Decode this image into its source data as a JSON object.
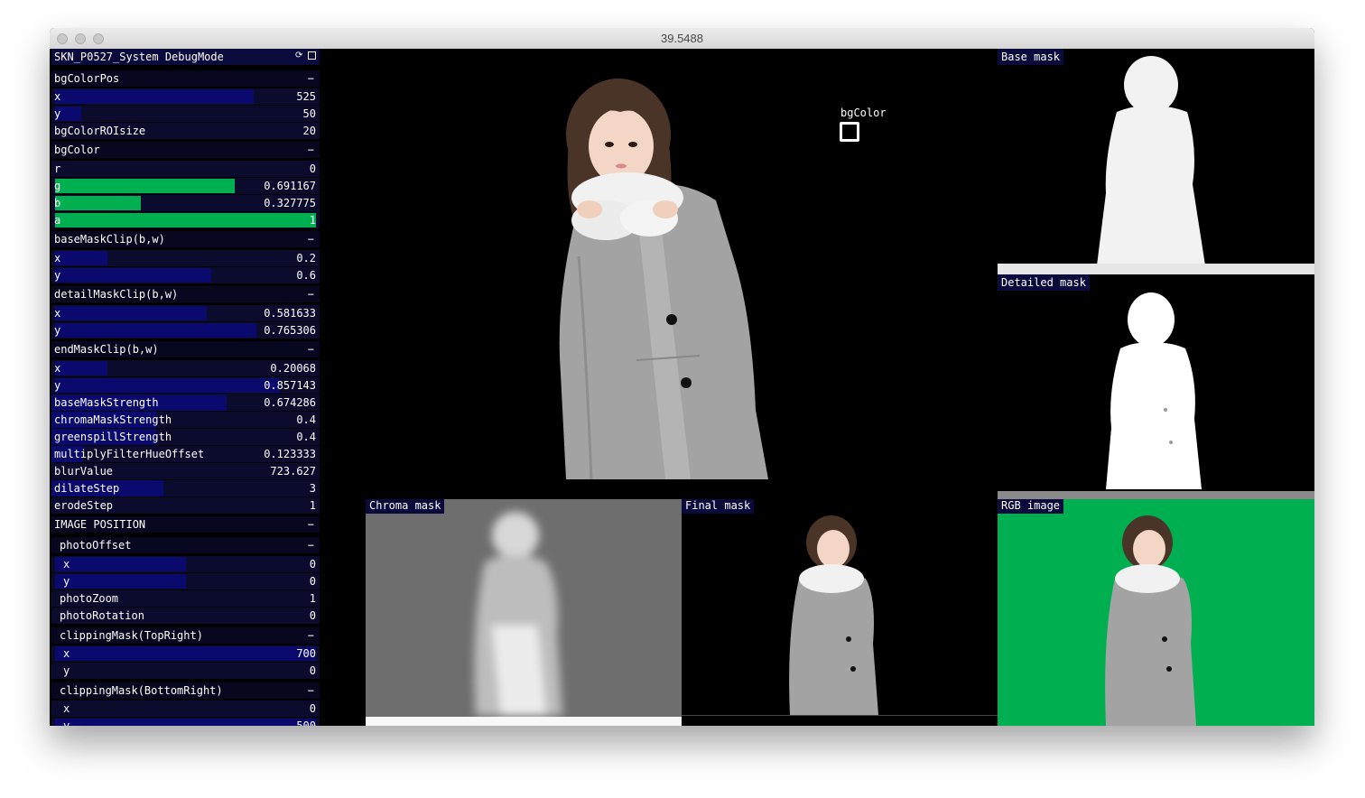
{
  "window": {
    "title": "39.5488"
  },
  "gui": {
    "header": "SKN_P0527_System DebugMode",
    "collapse_symbol": "−",
    "rows": [
      {
        "type": "group",
        "label": "bgColorPos",
        "value": "−"
      },
      {
        "type": "slider",
        "label": "x",
        "value": "525",
        "fill": 0.76
      },
      {
        "type": "slider",
        "label": "y",
        "value": "50",
        "fill": 0.1
      },
      {
        "type": "plain",
        "label": "bgColorROIsize",
        "value": "20"
      },
      {
        "type": "group",
        "label": "bgColor",
        "value": "−"
      },
      {
        "type": "slider",
        "label": "r",
        "value": "0",
        "fill": 0.0,
        "color": "#0a0a6e"
      },
      {
        "type": "slider",
        "label": "g",
        "value": "0.691167",
        "fill": 0.69,
        "color": "#00b050"
      },
      {
        "type": "slider",
        "label": "b",
        "value": "0.327775",
        "fill": 0.33,
        "color": "#00b050"
      },
      {
        "type": "slider",
        "label": "a",
        "value": "1",
        "fill": 1.0,
        "color": "#00b050"
      },
      {
        "type": "group",
        "label": "baseMaskClip(b,w)",
        "value": "−"
      },
      {
        "type": "slider",
        "label": "x",
        "value": "0.2",
        "fill": 0.2
      },
      {
        "type": "slider",
        "label": "y",
        "value": "0.6",
        "fill": 0.6
      },
      {
        "type": "group",
        "label": "detailMaskClip(b,w)",
        "value": "−"
      },
      {
        "type": "slider",
        "label": "x",
        "value": "0.581633",
        "fill": 0.58
      },
      {
        "type": "slider",
        "label": "y",
        "value": "0.765306",
        "fill": 0.77
      },
      {
        "type": "group",
        "label": "endMaskClip(b,w)",
        "value": "−"
      },
      {
        "type": "slider",
        "label": "x",
        "value": "0.20068",
        "fill": 0.2
      },
      {
        "type": "slider",
        "label": "y",
        "value": "0.857143",
        "fill": 0.86
      },
      {
        "type": "slider",
        "label": "baseMaskStrength",
        "value": "0.674286",
        "fill": 0.67,
        "flat": true
      },
      {
        "type": "slider",
        "label": "chromaMaskStrength",
        "value": "0.4",
        "fill": 0.4,
        "flat": true
      },
      {
        "type": "slider",
        "label": "greenspillStrength",
        "value": "0.4",
        "fill": 0.4,
        "flat": true
      },
      {
        "type": "slider",
        "label": "multiplyFilterHueOffset",
        "value": "0.123333",
        "fill": 0.12,
        "flat": true
      },
      {
        "type": "slider",
        "label": "blurValue",
        "value": "723.627",
        "fill": 0.0,
        "flat": true
      },
      {
        "type": "slider",
        "label": "dilateStep",
        "value": "3",
        "fill": 0.43,
        "flat": true
      },
      {
        "type": "slider",
        "label": "erodeStep",
        "value": "1",
        "fill": 0.0,
        "flat": true
      },
      {
        "type": "group",
        "label": "IMAGE POSITION",
        "value": "−"
      },
      {
        "type": "group",
        "label": "photoOffset",
        "value": "−",
        "sub": true
      },
      {
        "type": "slider",
        "label": "x",
        "value": "0",
        "fill": 0.5,
        "sub2": true
      },
      {
        "type": "slider",
        "label": "y",
        "value": "0",
        "fill": 0.5,
        "sub2": true
      },
      {
        "type": "slider",
        "label": "photoZoom",
        "value": "1",
        "fill": 0.0,
        "sub": true
      },
      {
        "type": "slider",
        "label": "photoRotation",
        "value": "0",
        "fill": 0.0,
        "sub": true
      },
      {
        "type": "group",
        "label": "clippingMask(TopRight)",
        "value": "−",
        "sub": true
      },
      {
        "type": "slider",
        "label": "x",
        "value": "700",
        "fill": 1.0,
        "sub2": true
      },
      {
        "type": "slider",
        "label": "y",
        "value": "0",
        "fill": 0.0,
        "sub2": true
      },
      {
        "type": "group",
        "label": "clippingMask(BottomRight)",
        "value": "−",
        "sub": true
      },
      {
        "type": "slider",
        "label": "x",
        "value": "0",
        "fill": 0.0,
        "sub2": true
      },
      {
        "type": "slider",
        "label": "y",
        "value": "500",
        "fill": 1.0,
        "sub2": true
      }
    ]
  },
  "main": {
    "bgcolor_label": "bgColor"
  },
  "panels": {
    "base_mask": "Base mask",
    "detailed_mask": "Detailed mask",
    "chroma_mask": "Chroma mask",
    "final_mask": "Final mask",
    "rgb_image": "RGB image"
  },
  "colors": {
    "green_screen": "#00b050",
    "mask_white": "#f2f2f2",
    "chroma_gray": "#6e6e6e",
    "slider_fill": "#0a0a6e",
    "panel_label_bg": "#0a0a3c"
  }
}
